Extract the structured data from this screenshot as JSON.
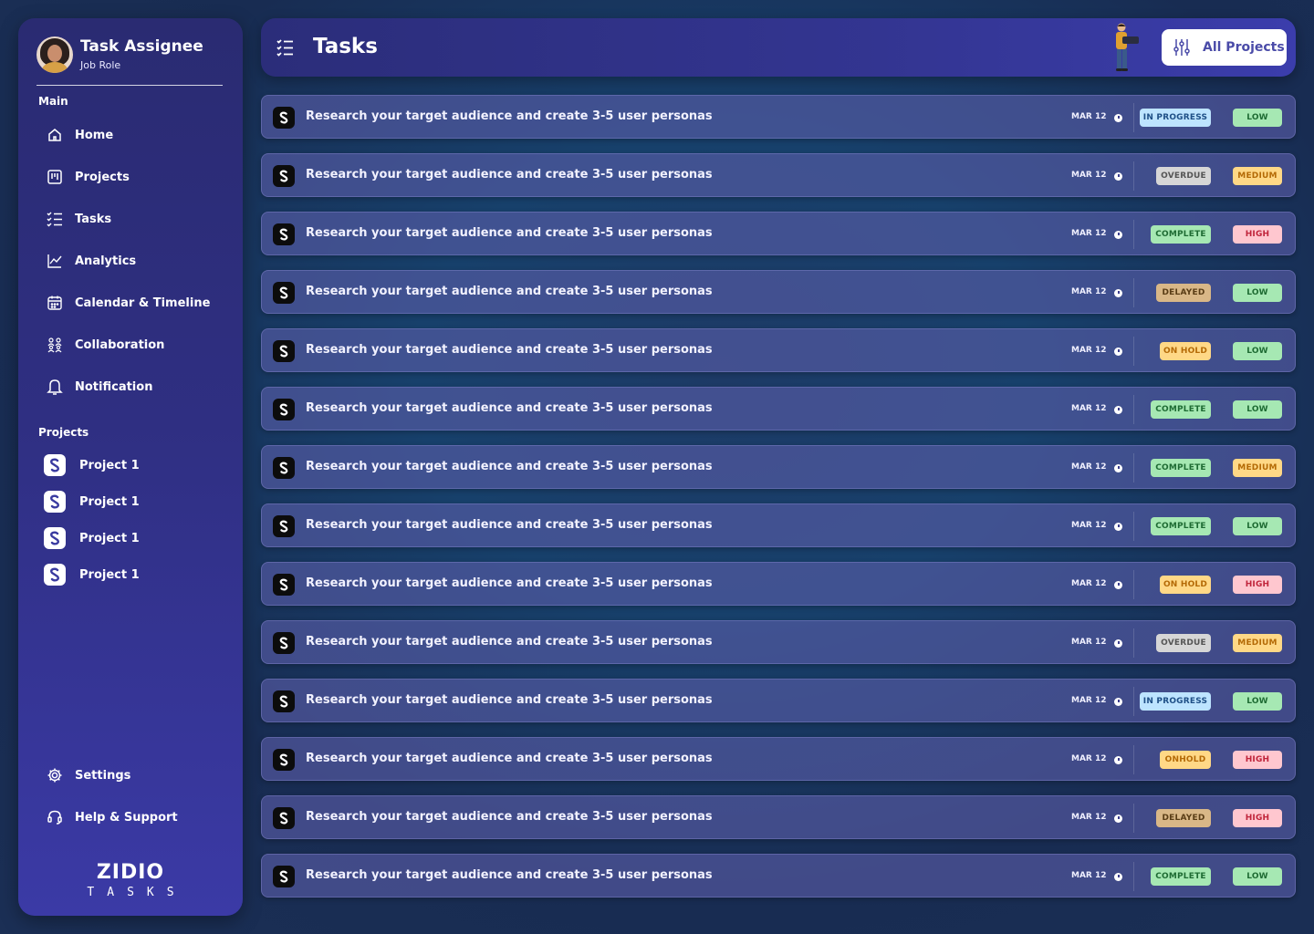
{
  "profile": {
    "name": "Task Assignee",
    "role": "Job Role"
  },
  "sidebar": {
    "main_label": "Main",
    "nav": [
      {
        "label": "Home",
        "icon": "home-icon"
      },
      {
        "label": "Projects",
        "icon": "projects-icon"
      },
      {
        "label": "Tasks",
        "icon": "tasks-icon"
      },
      {
        "label": "Analytics",
        "icon": "analytics-icon"
      },
      {
        "label": "Calendar & Timeline",
        "icon": "calendar-icon"
      },
      {
        "label": "Collaboration",
        "icon": "collaboration-icon"
      },
      {
        "label": "Notification",
        "icon": "bell-icon"
      }
    ],
    "projects_label": "Projects",
    "projects": [
      {
        "label": "Project 1"
      },
      {
        "label": "Project 1"
      },
      {
        "label": "Project 1"
      },
      {
        "label": "Project 1"
      }
    ],
    "bottom": [
      {
        "label": "Settings",
        "icon": "gear-icon"
      },
      {
        "label": "Help & Support",
        "icon": "headset-icon"
      }
    ],
    "brand": {
      "name": "ZIDIO",
      "sub": "TASKS"
    }
  },
  "header": {
    "title": "Tasks",
    "filter_label": "All Projects"
  },
  "tasks": [
    {
      "text": "Research your target audience and create 3-5 user personas",
      "date": "MAR 12",
      "status": "IN PROGRESS",
      "priority": "LOW"
    },
    {
      "text": "Research your target audience and create 3-5 user personas",
      "date": "MAR 12",
      "status": "OVERDUE",
      "priority": "MEDIUM"
    },
    {
      "text": "Research your target audience and create 3-5 user personas",
      "date": "MAR 12",
      "status": "COMPLETE",
      "priority": "HIGH"
    },
    {
      "text": "Research your target audience and create 3-5 user personas",
      "date": "MAR 12",
      "status": "DELAYED",
      "priority": "LOW"
    },
    {
      "text": "Research your target audience and create 3-5 user personas",
      "date": "MAR 12",
      "status": "ON HOLD",
      "priority": "LOW"
    },
    {
      "text": "Research your target audience and create 3-5 user personas",
      "date": "MAR 12",
      "status": "COMPLETE",
      "priority": "LOW"
    },
    {
      "text": "Research your target audience and create 3-5 user personas",
      "date": "MAR 12",
      "status": "COMPLETE",
      "priority": "MEDIUM"
    },
    {
      "text": "Research your target audience and create 3-5 user personas",
      "date": "MAR 12",
      "status": "COMPLETE",
      "priority": "LOW"
    },
    {
      "text": "Research your target audience and create 3-5 user personas",
      "date": "MAR 12",
      "status": "ON HOLD",
      "priority": "HIGH"
    },
    {
      "text": "Research your target audience and create 3-5 user personas",
      "date": "MAR 12",
      "status": "OVERDUE",
      "priority": "MEDIUM"
    },
    {
      "text": "Research your target audience and create 3-5 user personas",
      "date": "MAR 12",
      "status": "IN PROGRESS",
      "priority": "LOW"
    },
    {
      "text": "Research your target audience and create 3-5 user personas",
      "date": "MAR 12",
      "status": "ONHOLD",
      "priority": "HIGH"
    },
    {
      "text": "Research your target audience and create 3-5 user personas",
      "date": "MAR 12",
      "status": "DELAYED",
      "priority": "HIGH"
    },
    {
      "text": "Research your target audience and create 3-5 user personas",
      "date": "MAR 12",
      "status": "COMPLETE",
      "priority": "LOW"
    }
  ],
  "colors": {
    "sidebar_top": "#2a2b72",
    "sidebar_bottom": "#3b3aa6",
    "accent": "#4a4ba8",
    "status_in_progress": "#bde4ff",
    "status_overdue": "#d6d6d6",
    "status_complete": "#a6e8b3",
    "status_delayed": "#d9b787",
    "status_on_hold": "#ffd886",
    "priority_low": "#a6e8b3",
    "priority_medium": "#ffd886",
    "priority_high": "#ffc7cf"
  }
}
